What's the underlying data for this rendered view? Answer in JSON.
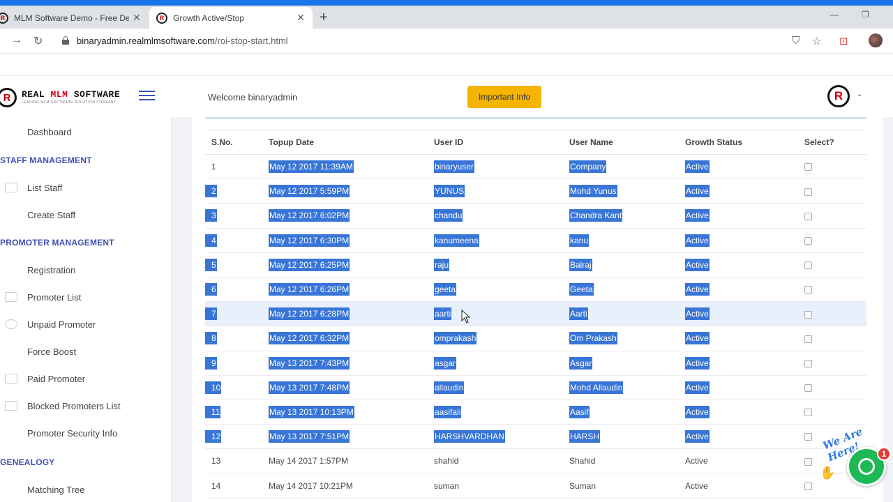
{
  "browser": {
    "tabs": [
      {
        "title": "MLM Software Demo - Free Dem",
        "active": false
      },
      {
        "title": "Growth Active/Stop",
        "active": true
      }
    ],
    "url_host": "binaryadmin.realmlmsoftware.com",
    "url_path": "/roi-stop-start.html"
  },
  "header": {
    "logo_text_a": "REAL ",
    "logo_text_b": "MLM",
    "logo_text_c": " SOFTWARE",
    "logo_tagline": "LEADING MLM SOFTWARE SOLUTION COMPANY",
    "welcome": "Welcome binaryadmin",
    "important_info": "Important Info"
  },
  "sidebar": {
    "dashboard": "Dashboard",
    "staff_head": "STAFF MANAGEMENT",
    "list_staff": "List Staff",
    "create_staff": "Create Staff",
    "promoter_head": "PROMOTER MANAGEMENT",
    "registration": "Registration",
    "promoter_list": "Promoter List",
    "unpaid_promoter": "Unpaid Promoter",
    "force_boost": "Force Boost",
    "paid_promoter": "Paid Promoter",
    "blocked_promoters": "Blocked Promoters List",
    "promoter_security": "Promoter Security Info",
    "genealogy_head": "GENEALOGY",
    "matching_tree": "Matching Tree"
  },
  "table": {
    "headers": {
      "sno": "S.No.",
      "topup": "Topup Date",
      "userid": "User ID",
      "username": "User Name",
      "status": "Growth Status",
      "select": "Select?"
    },
    "rows": [
      {
        "sno": "1",
        "date": "May 12 2017 11:39AM",
        "uid": "binaryuser",
        "name": "Company",
        "status": "Active"
      },
      {
        "sno": "2",
        "date": "May 12 2017 5:59PM",
        "uid": "YUNUS",
        "name": "Mohd Yunus",
        "status": "Active"
      },
      {
        "sno": "3",
        "date": "May 12 2017 6:02PM",
        "uid": "chandu",
        "name": "Chandra Kant",
        "status": "Active"
      },
      {
        "sno": "4",
        "date": "May 12 2017 6:30PM",
        "uid": "kanumeena",
        "name": "kanu",
        "status": "Active"
      },
      {
        "sno": "5",
        "date": "May 12 2017 6:25PM",
        "uid": "raju",
        "name": "Balraj",
        "status": "Active"
      },
      {
        "sno": "6",
        "date": "May 12 2017 6:26PM",
        "uid": "geeta",
        "name": "Geeta",
        "status": "Active"
      },
      {
        "sno": "7",
        "date": "May 12 2017 6:28PM",
        "uid": "aarti",
        "name": "Aarti",
        "status": "Active"
      },
      {
        "sno": "8",
        "date": "May 12 2017 6:32PM",
        "uid": "omprakash",
        "name": "Om Prakash",
        "status": "Active"
      },
      {
        "sno": "9",
        "date": "May 13 2017 7:43PM",
        "uid": "asgar",
        "name": "Asgar",
        "status": "Active"
      },
      {
        "sno": "10",
        "date": "May 13 2017 7:48PM",
        "uid": "allaudin",
        "name": "Mohd Allaudin",
        "status": "Active"
      },
      {
        "sno": "11",
        "date": "May 13 2017 10:13PM",
        "uid": "aasifali",
        "name": "Aasif",
        "status": "Active"
      },
      {
        "sno": "12",
        "date": "May 13 2017 7:51PM",
        "uid": "HARSHVARDHAN",
        "name": "HARSH",
        "status": "Active"
      },
      {
        "sno": "13",
        "date": "May 14 2017 1:57PM",
        "uid": "shahid",
        "name": "Shahid",
        "status": "Active"
      },
      {
        "sno": "14",
        "date": "May 14 2017 10:21PM",
        "uid": "suman",
        "name": "Suman",
        "status": "Active"
      }
    ]
  },
  "chat": {
    "badge_text": "We Are Here!",
    "unread_count": "1"
  },
  "colors": {
    "selection": "#3875d7",
    "accent": "#3f51b5",
    "button": "#f4b400",
    "chat": "#1db954"
  }
}
